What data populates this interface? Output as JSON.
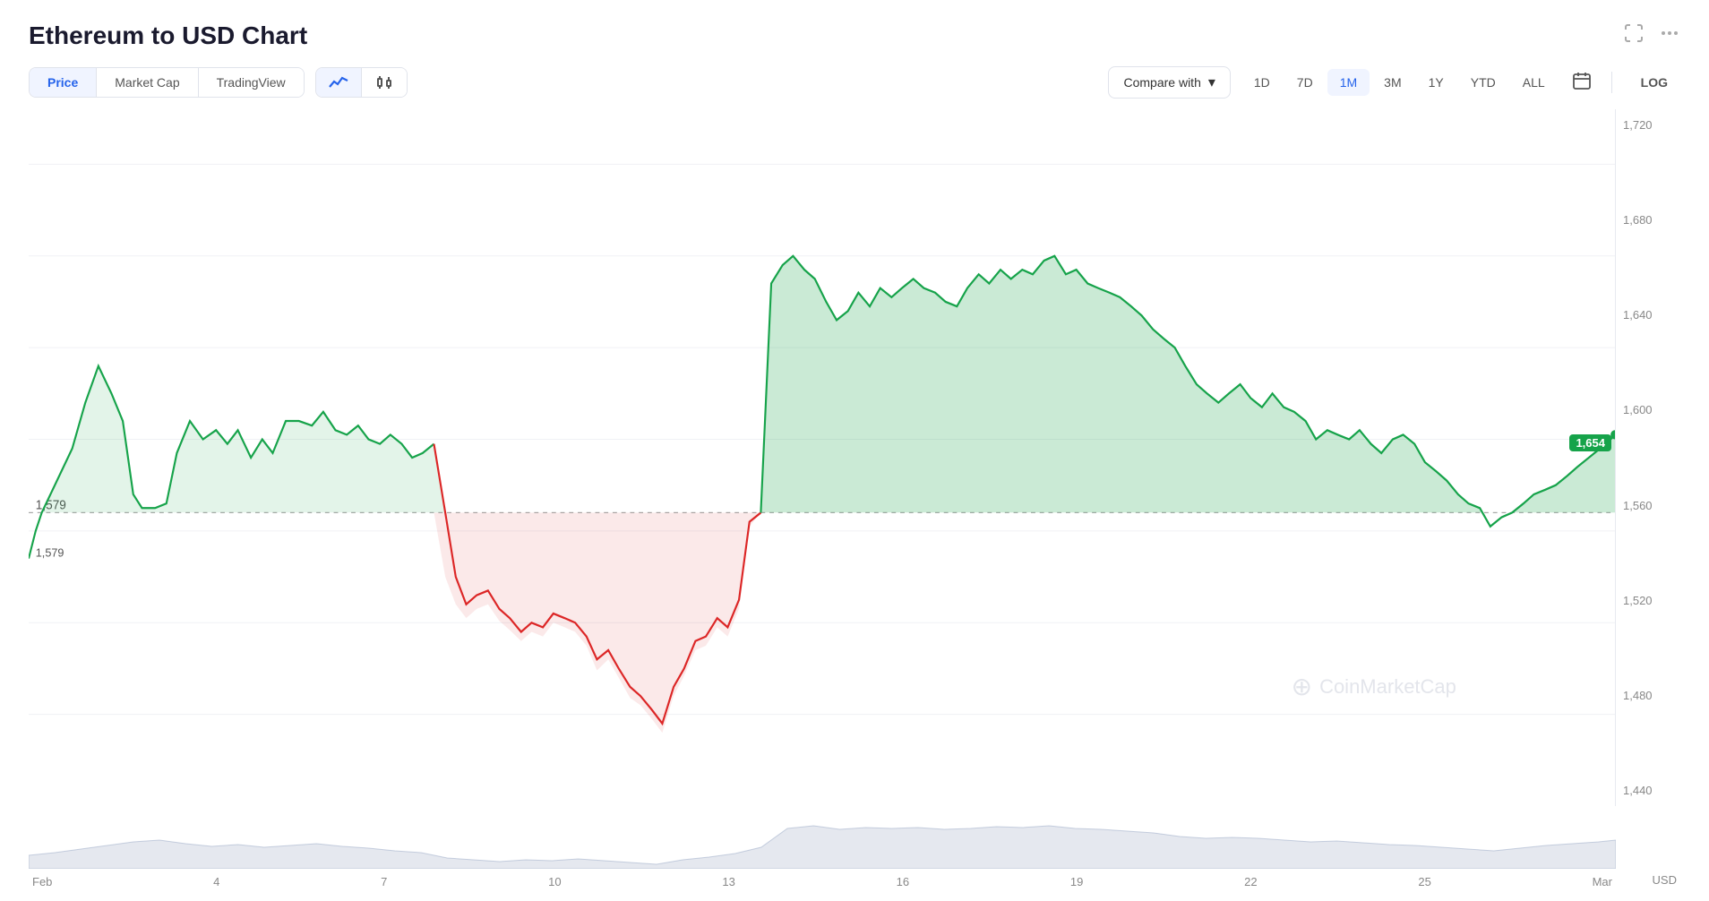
{
  "title": "Ethereum to USD Chart",
  "header": {
    "fullscreen_icon": "⛶",
    "more_icon": "···"
  },
  "tabs": [
    {
      "label": "Price",
      "active": true
    },
    {
      "label": "Market Cap",
      "active": false
    },
    {
      "label": "TradingView",
      "active": false
    }
  ],
  "chart_types": [
    {
      "icon": "line",
      "active": true
    },
    {
      "icon": "candle",
      "active": false
    }
  ],
  "compare": {
    "label": "Compare with",
    "chevron": "▾"
  },
  "time_periods": [
    {
      "label": "1D",
      "active": false
    },
    {
      "label": "7D",
      "active": false
    },
    {
      "label": "1M",
      "active": true
    },
    {
      "label": "3M",
      "active": false
    },
    {
      "label": "1Y",
      "active": false
    },
    {
      "label": "YTD",
      "active": false
    },
    {
      "label": "ALL",
      "active": false
    }
  ],
  "log_btn": "LOG",
  "y_axis_labels": [
    "1,720",
    "1,680",
    "1,640",
    "1,600",
    "1,560",
    "1,520",
    "1,480",
    "1,440"
  ],
  "current_price": "1,654",
  "reference_price": "1,579",
  "x_axis_labels": [
    "Feb",
    "4",
    "7",
    "10",
    "13",
    "16",
    "19",
    "22",
    "25",
    "Mar"
  ],
  "watermark": "CoinMarketCap",
  "usd_label": "USD"
}
